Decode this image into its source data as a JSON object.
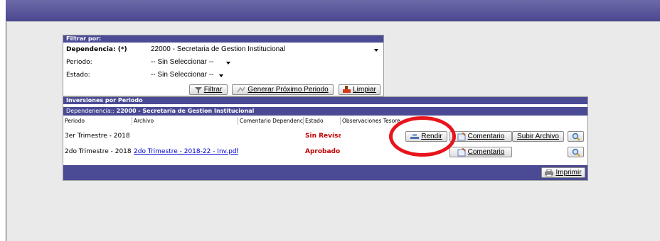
{
  "filter": {
    "title": "Filtrar por:",
    "dependencia_label": "Dependencia: (*)",
    "dependencia_value": "22000 - Secretaria de Gestion Institucional",
    "periodo_label": "Periodo:",
    "periodo_value": "-- Sin Seleccionar --",
    "estado_label": "Estado:",
    "estado_value": "-- Sin Seleccionar --",
    "btn_filtrar": "Filtrar",
    "btn_generar": "Generar Próximo Periodo",
    "btn_limpiar": "Limpiar"
  },
  "inversiones": {
    "title": "Inversiones por Periodo",
    "dependencia_prefix": "Dependenencia:: ",
    "dependencia_name": "22000 - Secretaria de Gestion Institucional",
    "columns": [
      "Periodo",
      "Archivo",
      "Comentario Dependencia",
      "Estado",
      "Observaciones Tesore"
    ],
    "rows": [
      {
        "periodo": "3er Trimestre - 2018",
        "archivo": "",
        "estado": "Sin Revisar",
        "btn_rendir": "Rendir",
        "btn_comentario": "Comentario",
        "btn_subir": "Subir Archivo"
      },
      {
        "periodo": "2do Trimestre - 2018",
        "archivo": "2do Trimestre - 2018-22 - Inv.pdf",
        "estado": "Aprobado",
        "btn_comentario": "Comentario"
      }
    ],
    "btn_imprimir": "Imprimir"
  },
  "colors": {
    "header_bg": "#4a4a95",
    "status_red": "#c00000",
    "highlight_ring": "#e8141c"
  }
}
